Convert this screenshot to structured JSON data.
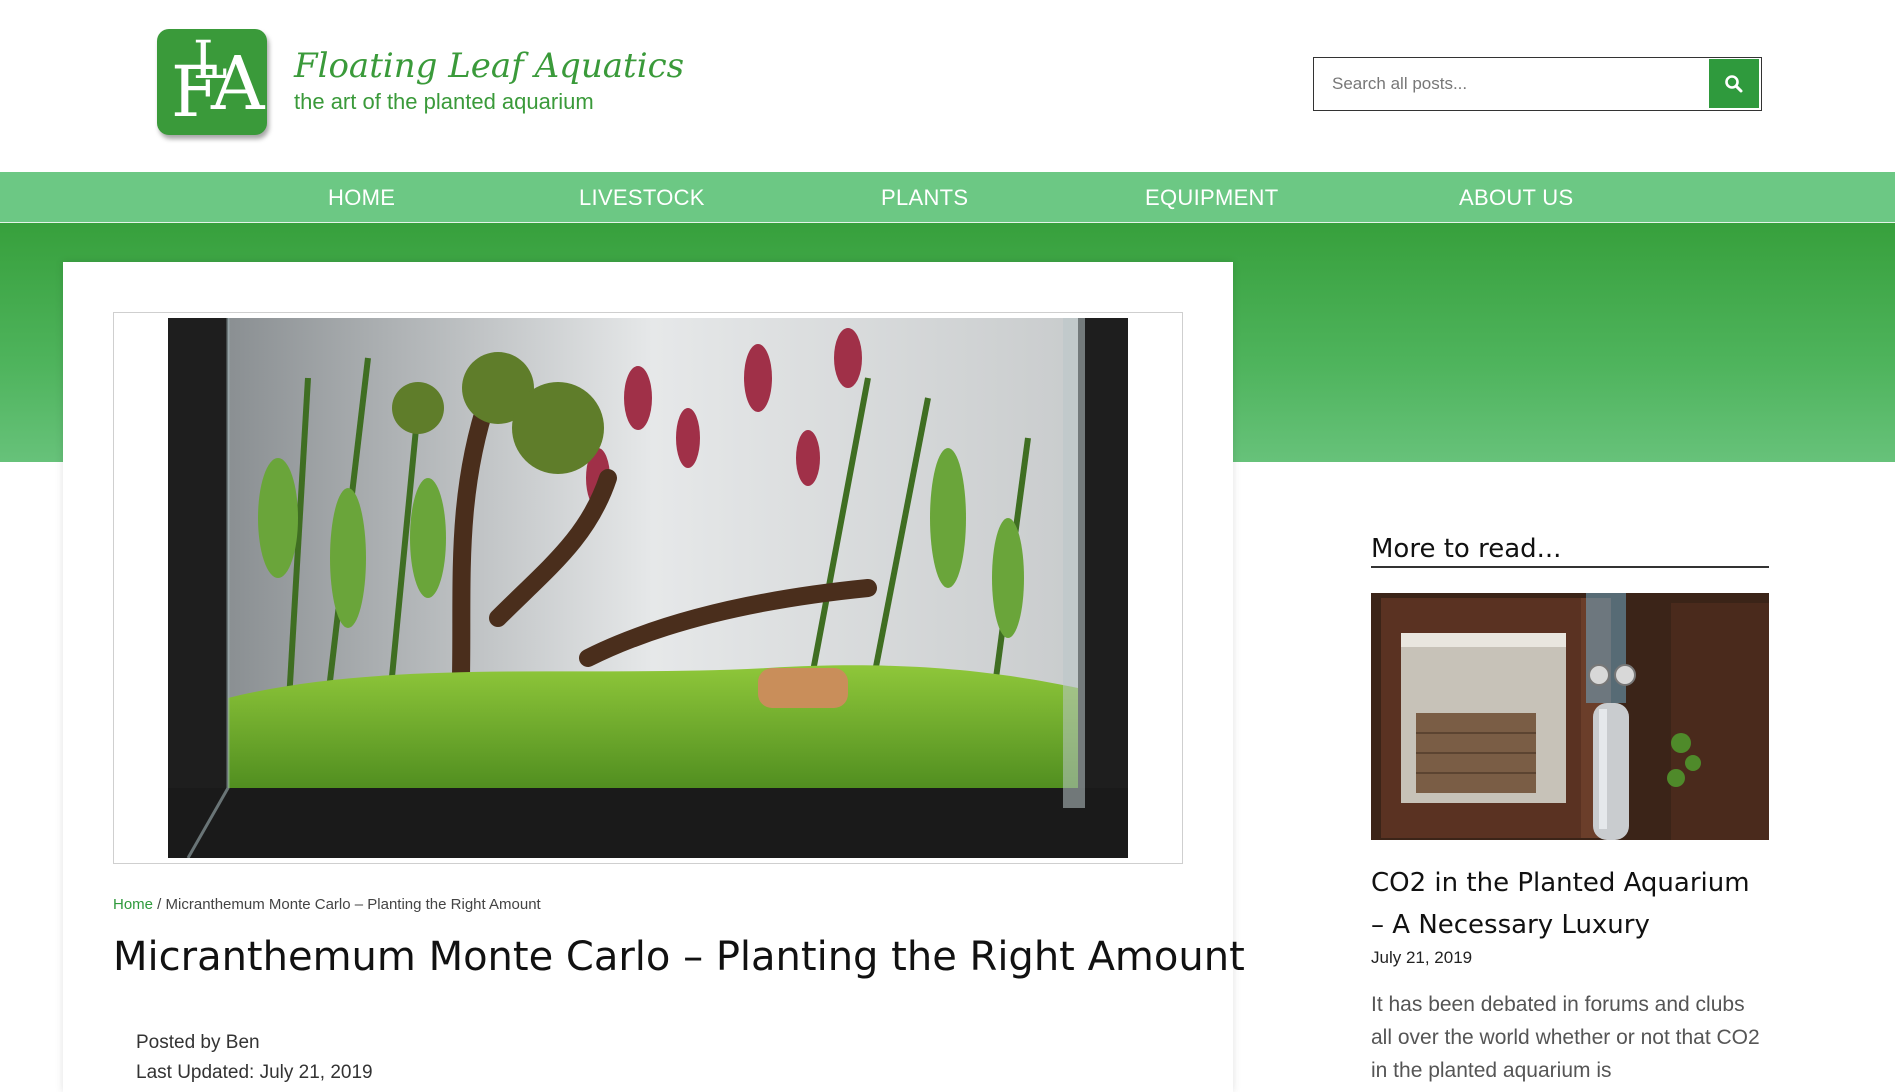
{
  "header": {
    "logo_letters": "FLA",
    "site_title": "Floating Leaf Aquatics",
    "tagline": "the art of the planted aquarium",
    "search": {
      "placeholder": "Search all posts...",
      "button_icon": "search-icon"
    }
  },
  "nav": {
    "items": [
      {
        "label": "HOME"
      },
      {
        "label": "LIVESTOCK"
      },
      {
        "label": "PLANTS"
      },
      {
        "label": "EQUIPMENT"
      },
      {
        "label": "ABOUT US"
      }
    ]
  },
  "post": {
    "breadcrumb": {
      "home": "Home",
      "separator": " / ",
      "current": "Micranthemum Monte Carlo – Planting the Right Amount"
    },
    "title": "Micranthemum Monte Carlo – Planting the Right Amount",
    "posted_by": "Posted by Ben",
    "posted_date": "Last Updated: July 21, 2019"
  },
  "sidebar": {
    "heading": "More to read...",
    "featured": {
      "title": "CO2 in the Planted Aquarium – A Necessary Luxury",
      "date": "July 21, 2019",
      "excerpt": "It has been debated in forums and clubs all over the world whether or not that CO2 in the planted aquarium is"
    }
  },
  "colors": {
    "brand_green": "#3a9a3a",
    "nav_green": "#6cc884",
    "hero_green": "#37a03c",
    "button_green": "#2f9a3d"
  }
}
